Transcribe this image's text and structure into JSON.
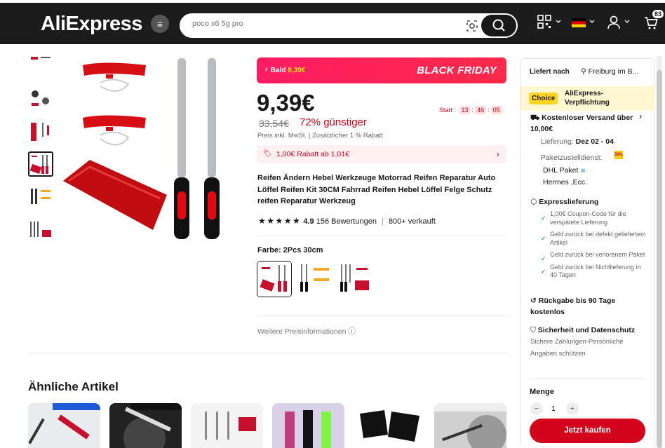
{
  "header": {
    "logo": "AliExpress",
    "search_placeholder": "poco x6 5g pro",
    "cart_count": "83"
  },
  "promo": {
    "bald_prefix": "Bald",
    "bald_price": "8,39€",
    "event": "BLACK FRIDAY"
  },
  "price": {
    "current": "9,39€",
    "original": "33,54€",
    "discount": "72% günstiger",
    "tax_note": "Preis inkl. MwSt.",
    "extra_discount": "Zusätzlicher 1 % Rabatt",
    "start_label": "Start :",
    "timer": [
      "13",
      "46",
      "05"
    ]
  },
  "coupon": {
    "text": "1,00€ Rabatt ab 1,01€"
  },
  "product": {
    "title": "Reifen Ändern Hebel Werkzeuge Motorrad Reifen Reparatur Auto Löffel Reifen Kit 30CM Fahrrad Reifen Hebel Löffel Felge Schutz reifen Reparatur Werkzeug",
    "rating": "4.9",
    "reviews": "156 Bewertungen",
    "sold": "800+ verkauft",
    "color_label": "Farbe: 2Pcs 30cm",
    "more_price_info": "Weitere Preisinformationen"
  },
  "similar": {
    "heading": "Ähnliche Artikel"
  },
  "sidebar": {
    "delivery_label": "Liefert nach",
    "location": "Freiburg im B...",
    "choice_badge": "Choice",
    "choice_text": "AliExpress-Verpflichtung",
    "shipping_title": "Kostenloser Versand über 10,00€",
    "delivery_prefix": "Lieferung:",
    "delivery_date": "Dez 02 - 04",
    "carrier_label": "Paketzustelldienst:",
    "carrier_1": "DHL Paket",
    "carrier_2": "Hermes ,Ecc.",
    "express_title": "Expresslieferung",
    "express_items": [
      "1,00€ Coupon-Code für die verspätete Lieferung",
      "Geld zurück bei defekt geliefertem Artikel",
      "Geld zurück bei verlorenem Paket",
      "Geld zurück bei Nichtlieferung in 40 Tagen"
    ],
    "return_title": "Rückgabe bis 90 Tage kostenlos",
    "security_title": "Sicherheit und Datenschutz",
    "security_text": "Sichere Zahlungen-Persönliche Angaben schützen",
    "qty_label": "Menge",
    "qty_value": "1",
    "buy_label": "Jetzt kaufen"
  },
  "colors": {
    "brand_red": "#d3031c",
    "header_bg": "#1c1c1c",
    "promo_pink": "#ff1c63"
  }
}
